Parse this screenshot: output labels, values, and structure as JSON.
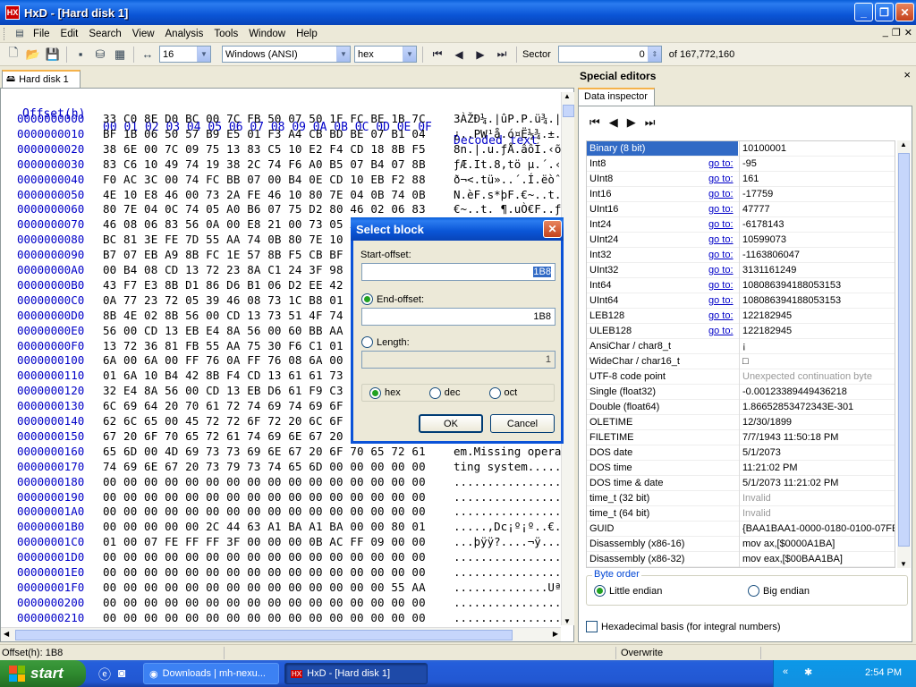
{
  "window": {
    "title": "HxD - [Hard disk 1]"
  },
  "menu": [
    "File",
    "Edit",
    "Search",
    "View",
    "Analysis",
    "Tools",
    "Window",
    "Help"
  ],
  "toolbar": {
    "bytes_per_row": "16",
    "charset": "Windows (ANSI)",
    "offset_base": "hex",
    "sector_label": "Sector",
    "sector_value": "0",
    "sector_total": "of 167,772,160"
  },
  "doc_tab": "Hard disk 1",
  "hex_header": {
    "offset": "Offset(h)",
    "cols": [
      "00",
      "01",
      "02",
      "03",
      "04",
      "05",
      "06",
      "07",
      "08",
      "09",
      "0A",
      "0B",
      "0C",
      "0D",
      "0E",
      "0F"
    ],
    "decoded": "Decoded text"
  },
  "rows": [
    {
      "off": "0000000000",
      "hex": "33 C0 8E D0 BC 00 7C FB 50 07 50 1F FC BE 1B 7C",
      "dec": "3ÀŽĐ¼.|ûP.P.ü¾.|"
    },
    {
      "off": "0000000010",
      "hex": "BF 1B 06 50 57 B9 E5 01 F3 A4 CB BD BE 07 B1 04",
      "dec": "¿..PW¹å.ó¤Ë½¾.±."
    },
    {
      "off": "0000000020",
      "hex": "38 6E 00 7C 09 75 13 83 C5 10 E2 F4 CD 18 8B F5",
      "dec": "8n.|.u.ƒÅ.âôÍ.‹õ"
    },
    {
      "off": "0000000030",
      "hex": "83 C6 10 49 74 19 38 2C 74 F6 A0 B5 07 B4 07 8B",
      "dec": "ƒÆ.It.8,tö µ.´.‹"
    },
    {
      "off": "0000000040",
      "hex": "F0 AC 3C 00 74 FC BB 07 00 B4 0E CD 10 EB F2 88",
      "dec": "ð¬<.tü»..´.Í.ëòˆ"
    },
    {
      "off": "0000000050",
      "hex": "4E 10 E8 46 00 73 2A FE 46 10 80 7E 04 0B 74 0B",
      "dec": "N.èF.s*þF.€~..t."
    },
    {
      "off": "0000000060",
      "hex": "80 7E 04 0C 74 05 A0 B6 07 75 D2 80 46 02 06 83",
      "dec": "€~..t. ¶.uÒ€F..ƒ"
    },
    {
      "off": "0000000070",
      "hex": "46 08 06 83 56 0A 00 E8 21 00 73 05 A0 B6 07 EB",
      "dec": "F..ƒV..è!.s. ¶.ë"
    },
    {
      "off": "0000000080",
      "hex": "BC 81 3E FE 7D 55 AA 74 0B 80 7E 10 00 74 C8 A0",
      "dec": "¼.>þ}Uªt.€~..tÈ "
    },
    {
      "off": "0000000090",
      "hex": "B7 07 EB A9 8B FC 1E 57 8B F5 CB BF 05 00 8A 56",
      "dec": "·.ë©‹ü.W‹õË¿..ŠV"
    },
    {
      "off": "00000000A0",
      "hex": "00 B4 08 CD 13 72 23 8A C1 24 3F 98 8A DE 8A FC",
      "dec": ".´.Í.r#ŠÁ$?˜ŠÞŠü"
    },
    {
      "off": "00000000B0",
      "hex": "43 F7 E3 8B D1 86 D6 B1 06 D2 EE 42 F7 E2 39 56",
      "dec": "C÷ã‹Ñ†Ö±.ÒîB÷â9V"
    },
    {
      "off": "00000000C0",
      "hex": "0A 77 23 72 05 39 46 08 73 1C B8 01 02 BB 00 7C",
      "dec": ".w#r.9F.s.¸..».|"
    },
    {
      "off": "00000000D0",
      "hex": "8B 4E 02 8B 56 00 CD 13 73 51 4F 74 4E 32 E4 8A",
      "dec": "‹N.‹V.Í.sQOtN2äŠ"
    },
    {
      "off": "00000000E0",
      "hex": "56 00 CD 13 EB E4 8A 56 00 60 BB AA 55 B4 41 CD",
      "dec": "V.Í.ëäŠV.`»ªU´AÍ"
    },
    {
      "off": "00000000F0",
      "hex": "13 72 36 81 FB 55 AA 75 30 F6 C1 01 74 2B 61 60",
      "dec": ".r6.ûUªu0öÁ.t+a`"
    },
    {
      "off": "0000000100",
      "hex": "6A 00 6A 00 FF 76 0A FF 76 08 6A 00 68 00 7C 6A",
      "dec": "j.j.ÿv.ÿv.j.h.|j"
    },
    {
      "off": "0000000110",
      "hex": "01 6A 10 B4 42 8B F4 CD 13 61 61 73 0E 4F 74 0B",
      "dec": ".j.´B‹ôÍ.aas.Ot."
    },
    {
      "off": "0000000120",
      "hex": "32 E4 8A 56 00 CD 13 EB D6 61 F9 C3 49 6E 76 61",
      "dec": "2äŠV.Í.ëÖaùÃInva"
    },
    {
      "off": "0000000130",
      "hex": "6C 69 64 20 70 61 72 74 69 74 69 6F 6E 20 74 61",
      "dec": "lid partition ta"
    },
    {
      "off": "0000000140",
      "hex": "62 6C 65 00 45 72 72 6F 72 20 6C 6F 61 64 69 6E",
      "dec": "ble.Error loadin"
    },
    {
      "off": "0000000150",
      "hex": "67 20 6F 70 65 72 61 74 69 6E 67 20 73 79 73 74",
      "dec": "g operating syst"
    },
    {
      "off": "0000000160",
      "hex": "65 6D 00 4D 69 73 73 69 6E 67 20 6F 70 65 72 61",
      "dec": "em.Missing opera"
    },
    {
      "off": "0000000170",
      "hex": "74 69 6E 67 20 73 79 73 74 65 6D 00 00 00 00 00",
      "dec": "ting system....."
    },
    {
      "off": "0000000180",
      "hex": "00 00 00 00 00 00 00 00 00 00 00 00 00 00 00 00",
      "dec": "................"
    },
    {
      "off": "0000000190",
      "hex": "00 00 00 00 00 00 00 00 00 00 00 00 00 00 00 00",
      "dec": "................"
    },
    {
      "off": "00000001A0",
      "hex": "00 00 00 00 00 00 00 00 00 00 00 00 00 00 00 00",
      "dec": "................"
    },
    {
      "off": "00000001B0",
      "hex": "00 00 00 00 00 2C 44 63 A1 BA A1 BA 00 00 80 01",
      "dec": ".....,Dc¡º¡º..€."
    },
    {
      "off": "00000001C0",
      "hex": "01 00 07 FE FF FF 3F 00 00 00 0B AC FF 09 00 00",
      "dec": "...þÿÿ?....¬ÿ..."
    },
    {
      "off": "00000001D0",
      "hex": "00 00 00 00 00 00 00 00 00 00 00 00 00 00 00 00",
      "dec": "................"
    },
    {
      "off": "00000001E0",
      "hex": "00 00 00 00 00 00 00 00 00 00 00 00 00 00 00 00",
      "dec": "................"
    },
    {
      "off": "00000001F0",
      "hex": "00 00 00 00 00 00 00 00 00 00 00 00 00 00 55 AA",
      "dec": "..............Uª"
    },
    {
      "off": "0000000200",
      "hex": "00 00 00 00 00 00 00 00 00 00 00 00 00 00 00 00",
      "dec": "................"
    },
    {
      "off": "0000000210",
      "hex": "00 00 00 00 00 00 00 00 00 00 00 00 00 00 00 00",
      "dec": "................"
    },
    {
      "off": "0000000220",
      "hex": "00 00 00 00 00 00 00 00 00 00 00 00 00 00 00 00",
      "dec": "................"
    },
    {
      "off": "0000000230",
      "hex": "00 00 00 00 00 00 00 00 00 00 00 00 00 00 00 00",
      "dec": "................"
    }
  ],
  "special_editors": {
    "title": "Special editors",
    "close": "×",
    "tab": "Data inspector"
  },
  "inspector": [
    {
      "name": "Binary (8 bit)",
      "goto": "",
      "value": "10100001",
      "gray": false,
      "sel": true
    },
    {
      "name": "Int8",
      "goto": "go to:",
      "value": "-95"
    },
    {
      "name": "UInt8",
      "goto": "go to:",
      "value": "161"
    },
    {
      "name": "Int16",
      "goto": "go to:",
      "value": "-17759"
    },
    {
      "name": "UInt16",
      "goto": "go to:",
      "value": "47777"
    },
    {
      "name": "Int24",
      "goto": "go to:",
      "value": "-6178143"
    },
    {
      "name": "UInt24",
      "goto": "go to:",
      "value": "10599073"
    },
    {
      "name": "Int32",
      "goto": "go to:",
      "value": "-1163806047"
    },
    {
      "name": "UInt32",
      "goto": "go to:",
      "value": "3131161249"
    },
    {
      "name": "Int64",
      "goto": "go to:",
      "value": "108086394188053153"
    },
    {
      "name": "UInt64",
      "goto": "go to:",
      "value": "108086394188053153"
    },
    {
      "name": "LEB128",
      "goto": "go to:",
      "value": "122182945"
    },
    {
      "name": "ULEB128",
      "goto": "go to:",
      "value": "122182945"
    },
    {
      "name": "AnsiChar / char8_t",
      "goto": "",
      "value": "¡"
    },
    {
      "name": "WideChar / char16_t",
      "goto": "",
      "value": "□"
    },
    {
      "name": "UTF-8 code point",
      "goto": "",
      "value": "Unexpected continuation byte",
      "gray": true
    },
    {
      "name": "Single (float32)",
      "goto": "",
      "value": "-0.00123389449436218"
    },
    {
      "name": "Double (float64)",
      "goto": "",
      "value": "1.86652853472343E-301"
    },
    {
      "name": "OLETIME",
      "goto": "",
      "value": "12/30/1899"
    },
    {
      "name": "FILETIME",
      "goto": "",
      "value": "7/7/1943 11:50:18 PM"
    },
    {
      "name": "DOS date",
      "goto": "",
      "value": "5/1/2073"
    },
    {
      "name": "DOS time",
      "goto": "",
      "value": "11:21:02 PM"
    },
    {
      "name": "DOS time & date",
      "goto": "",
      "value": "5/1/2073 11:21:02 PM"
    },
    {
      "name": "time_t (32 bit)",
      "goto": "",
      "value": "Invalid",
      "gray": true
    },
    {
      "name": "time_t (64 bit)",
      "goto": "",
      "value": "Invalid",
      "gray": true
    },
    {
      "name": "GUID",
      "goto": "",
      "value": "{BAA1BAA1-0000-0180-0100-07FE"
    },
    {
      "name": "Disassembly (x86-16)",
      "goto": "",
      "value": "mov ax,[$0000A1BA]"
    },
    {
      "name": "Disassembly (x86-32)",
      "goto": "",
      "value": "mov eax,[$00BAA1BA]"
    },
    {
      "name": "Disassembly (x86-64)",
      "goto": "",
      "value": "mov eax,[qword $101000000BAA1"
    }
  ],
  "byte_order": {
    "legend": "Byte order",
    "little": "Little endian",
    "big": "Big endian"
  },
  "hex_basis": "Hexadecimal basis (for integral numbers)",
  "dialog": {
    "title": "Select block",
    "start_label": "Start-offset:",
    "start_value": "1B8",
    "end_label": "End-offset:",
    "end_value": "1B8",
    "length_label": "Length:",
    "length_value": "1",
    "hex": "hex",
    "dec": "dec",
    "oct": "oct",
    "ok": "OK",
    "cancel": "Cancel"
  },
  "status": {
    "offset": "Offset(h): 1B8",
    "mode": "Overwrite"
  },
  "taskbar": {
    "start": "start",
    "task1": "Downloads | mh-nexu...",
    "task2": "HxD - [Hard disk 1]",
    "clock": "2:54 PM"
  }
}
